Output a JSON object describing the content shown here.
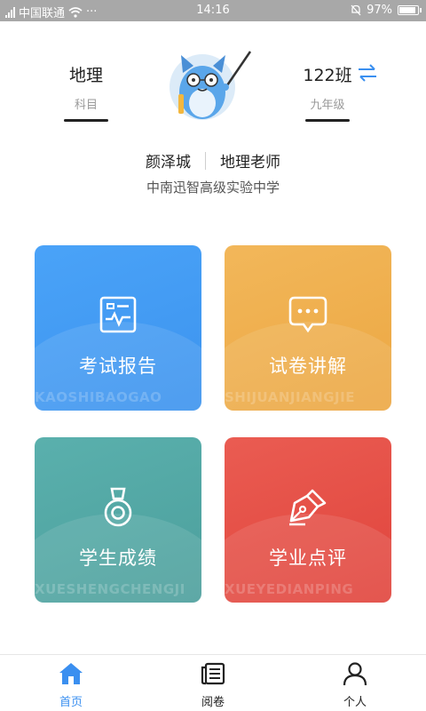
{
  "statusbar": {
    "carrier": "中国联通",
    "menu": "···",
    "time": "14:16",
    "battery_text": "97%",
    "battery_level": 0.97
  },
  "header": {
    "subject_value": "地理",
    "subject_label": "科目",
    "class_value": "122班",
    "class_label": "九年级",
    "teacher_name": "颜泽城",
    "teacher_role": "地理老师",
    "school": "中南迅智高级实验中学"
  },
  "cards": [
    {
      "title": "考试报告",
      "ghost": "KAOSHIBAOGAO",
      "color": "#4aa3f8",
      "icon": "report-icon"
    },
    {
      "title": "试卷讲解",
      "ghost": "SHIJUANJIANGJIE",
      "color": "#f2b75a",
      "icon": "chat-icon"
    },
    {
      "title": "学生成绩",
      "ghost": "XUESHENGCHENGJI",
      "color": "#5ab0ad",
      "icon": "medal-icon"
    },
    {
      "title": "学业点评",
      "ghost": "XUEYEDIANPING",
      "color": "#ea5c52",
      "icon": "pen-icon"
    }
  ],
  "tabbar": {
    "items": [
      {
        "label": "首页",
        "icon": "home-icon",
        "active": true
      },
      {
        "label": "阅卷",
        "icon": "papers-icon",
        "active": false
      },
      {
        "label": "个人",
        "icon": "person-icon",
        "active": false
      }
    ],
    "active_color": "#3a8ff0"
  }
}
